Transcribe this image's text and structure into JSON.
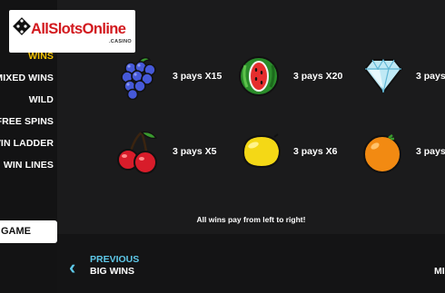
{
  "logo": {
    "text": "AllSlotsOnline",
    "sub": ".CASINO"
  },
  "menu": {
    "items": [
      {
        "label": "WINS",
        "active": true
      },
      {
        "label": "MIXED WINS",
        "active": false
      },
      {
        "label": "WILD",
        "active": false
      },
      {
        "label": "FREE SPINS",
        "active": false
      },
      {
        "label": "WIN LADDER",
        "active": false
      },
      {
        "label": "WIN LINES",
        "active": false
      }
    ],
    "game_button": "GAME"
  },
  "paytable": [
    {
      "icon": "grapes-icon",
      "text": "3 pays X15"
    },
    {
      "icon": "watermelon-icon",
      "text": "3 pays X20"
    },
    {
      "icon": "diamond-icon",
      "text": "3 pays"
    },
    {
      "icon": "cherries-icon",
      "text": "3 pays X5"
    },
    {
      "icon": "lemon-icon",
      "text": "3 pays X6"
    },
    {
      "icon": "orange-icon",
      "text": "3 pays"
    }
  ],
  "note": "All wins pay from left to right!",
  "nav": {
    "previous_label": "PREVIOUS",
    "previous_title": "BIG WINS",
    "next_title": "MI"
  },
  "colors": {
    "accent": "#f2c200",
    "nav": "#5ec8e8",
    "background": "#1b1b1c"
  }
}
